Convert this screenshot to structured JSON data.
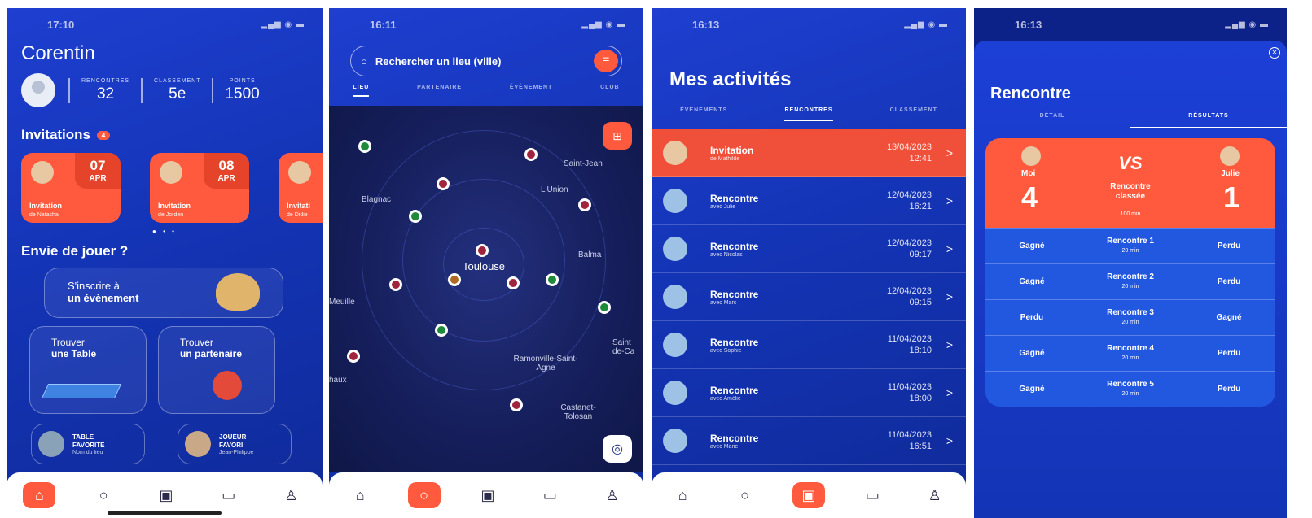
{
  "screen_home": {
    "status_time": "17:10",
    "user_name": "Corentin",
    "stats": [
      {
        "label": "RENCONTRES",
        "value": "32"
      },
      {
        "label": "CLASSEMENT",
        "value": "5e"
      },
      {
        "label": "POINTS",
        "value": "1500"
      }
    ],
    "invitations_title": "Invitations",
    "invitations_badge": "4",
    "invitations": [
      {
        "day": "07",
        "month": "APR",
        "title": "Invitation",
        "from": "de Natasha"
      },
      {
        "day": "08",
        "month": "APR",
        "title": "Invitation",
        "from": "de Jorden"
      },
      {
        "day": "",
        "month": "",
        "title": "Invitati",
        "from": "de Didie"
      }
    ],
    "play_title": "Envie de jouer ?",
    "event_button": {
      "line1": "S'inscrire à",
      "line2": "un évènement"
    },
    "find_table": {
      "line1": "Trouver",
      "line2": "une Table"
    },
    "find_partner": {
      "line1": "Trouver",
      "line2": "un partenaire"
    },
    "fav_table": {
      "line1": "TABLE",
      "line2": "FAVORITE",
      "sub": "Nom du lieu"
    },
    "fav_player": {
      "line1": "JOUEUR",
      "line2": "FAVORI",
      "sub": "Jean-Philippe"
    },
    "active_tab": 0
  },
  "screen_map": {
    "status_time": "16:11",
    "search_placeholder": "Rechercher un lieu (ville)",
    "tabs": [
      "LIEU",
      "PARTENAIRE",
      "ÉVÈNEMENT",
      "CLUB"
    ],
    "active_tab_index": 0,
    "places": [
      "Saint-Jean",
      "L'Union",
      "Blagnac",
      "Balma",
      "Toulouse",
      "Meuille",
      "Saint de-Ca",
      "Ramonville-Saint-Agne",
      "haux",
      "Castanet-Tolosan"
    ]
  },
  "screen_activities": {
    "status_time": "16:13",
    "title": "Mes activités",
    "tabs": [
      "ÉVÈNEMENTS",
      "RENCONTRES",
      "CLASSEMENT"
    ],
    "active_tab_index": 1,
    "items": [
      {
        "title": "Invitation",
        "sub": "de Mathilde",
        "date": "13/04/2023",
        "time": "12:41",
        "highlight": true
      },
      {
        "title": "Rencontre",
        "sub": "avec Julie",
        "date": "12/04/2023",
        "time": "16:21"
      },
      {
        "title": "Rencontre",
        "sub": "avec Nicolas",
        "date": "12/04/2023",
        "time": "09:17"
      },
      {
        "title": "Rencontre",
        "sub": "avec Marc",
        "date": "12/04/2023",
        "time": "09:15"
      },
      {
        "title": "Rencontre",
        "sub": "avec Sophie",
        "date": "11/04/2023",
        "time": "18:10"
      },
      {
        "title": "Rencontre",
        "sub": "avec Amélie",
        "date": "11/04/2023",
        "time": "18:00"
      },
      {
        "title": "Rencontre",
        "sub": "avec Marie",
        "date": "11/04/2023",
        "time": "16:51"
      }
    ]
  },
  "screen_result": {
    "status_time": "16:13",
    "title": "Rencontre",
    "tabs": [
      "DÉTAIL",
      "RÉSULTATS"
    ],
    "active_tab_index": 1,
    "player_left": "Moi",
    "player_right": "Julie",
    "score_left": "4",
    "score_right": "1",
    "vs": "VS",
    "match_type_line1": "Rencontre",
    "match_type_line2": "classée",
    "duration": "100 min",
    "rounds": [
      {
        "left": "Gagné",
        "name": "Rencontre 1",
        "dur": "20 min",
        "right": "Perdu"
      },
      {
        "left": "Gagné",
        "name": "Rencontre 2",
        "dur": "20 min",
        "right": "Perdu"
      },
      {
        "left": "Perdu",
        "name": "Rencontre 3",
        "dur": "20 min",
        "right": "Gagné"
      },
      {
        "left": "Gagné",
        "name": "Rencontre 4",
        "dur": "20 min",
        "right": "Perdu"
      },
      {
        "left": "Gagné",
        "name": "Rencontre 5",
        "dur": "20 min",
        "right": "Perdu"
      }
    ]
  },
  "colors": {
    "primary": "#1434b6",
    "accent": "#ff5a3d"
  }
}
